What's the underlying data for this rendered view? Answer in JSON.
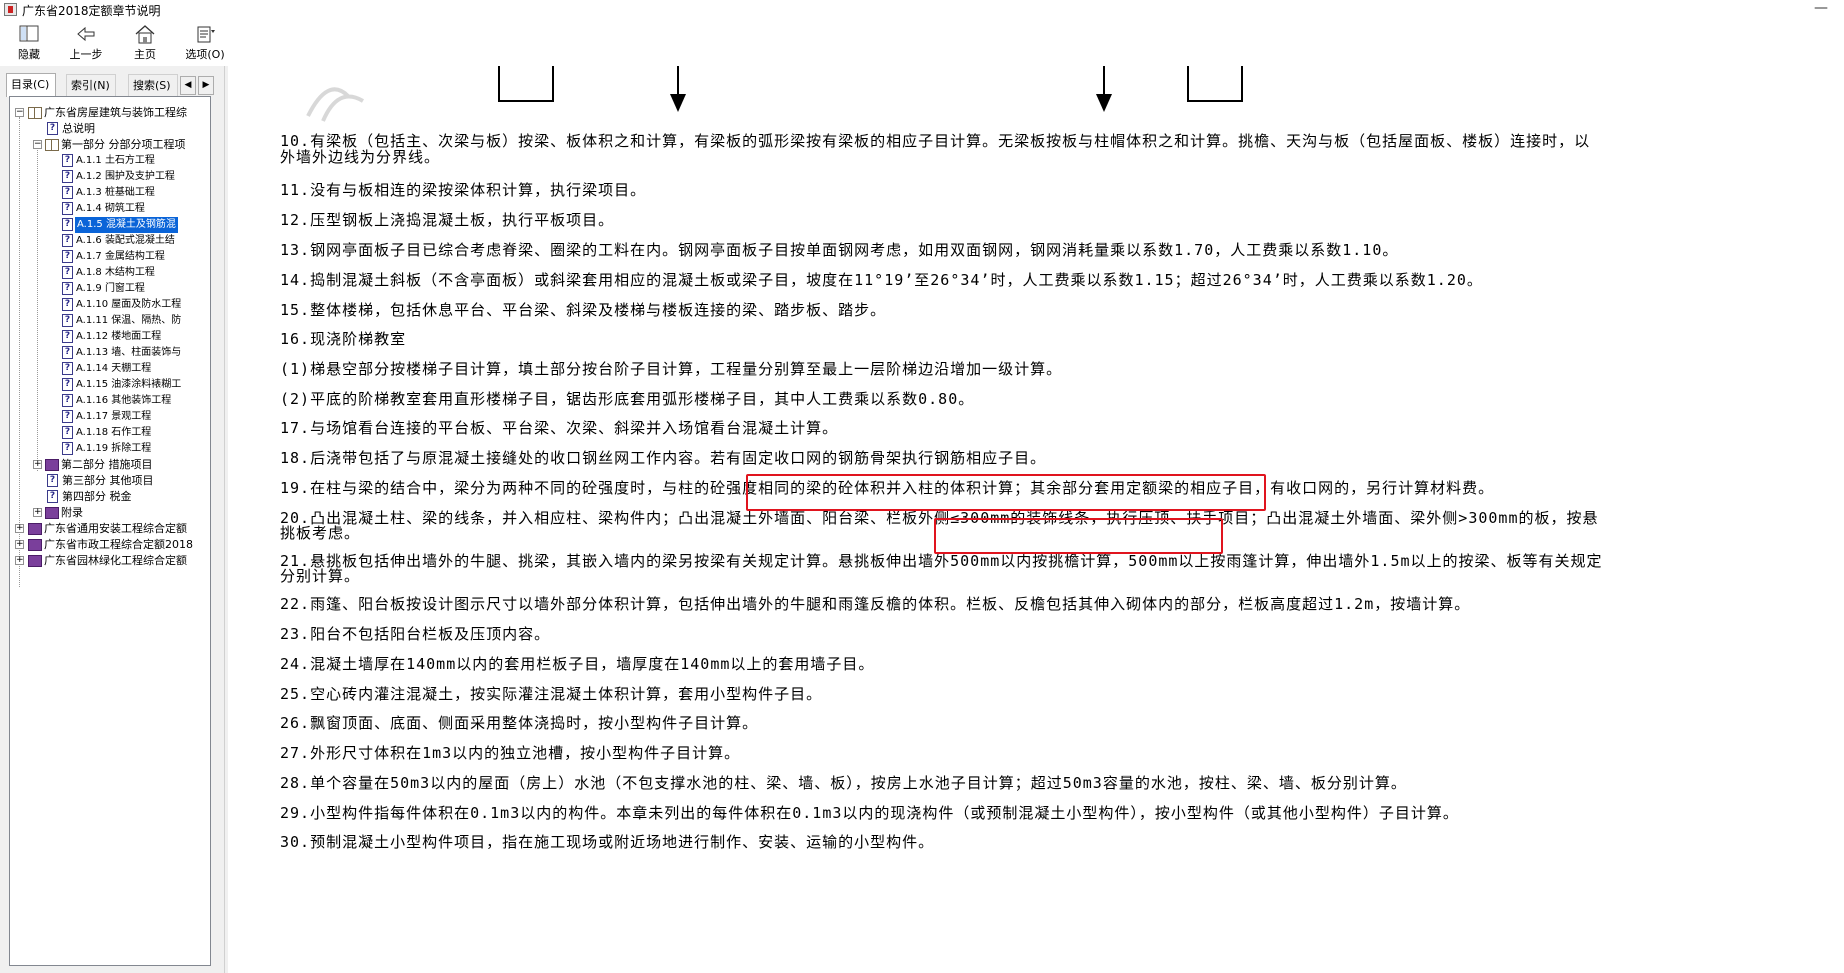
{
  "window": {
    "title": "广东省2018定额章节说明",
    "minimize": "—"
  },
  "toolbar": {
    "hide": "隐藏",
    "back": "上一步",
    "home": "主页",
    "options": "选项(O)"
  },
  "tabs": {
    "contents": "目录(C)",
    "index": "索引(N)",
    "search": "搜索(S)",
    "left_arrow": "◀",
    "right_arrow": "▶"
  },
  "tree": {
    "root": "广东省房屋建筑与装饰工程综",
    "general": "总说明",
    "part1": "第一部分 分部分项工程项",
    "items": [
      {
        "code": "A.1.1",
        "label": "土石方工程"
      },
      {
        "code": "A.1.2",
        "label": "围护及支护工程"
      },
      {
        "code": "A.1.3",
        "label": "桩基础工程"
      },
      {
        "code": "A.1.4",
        "label": "砌筑工程"
      },
      {
        "code": "A.1.5",
        "label": "混凝土及钢筋混"
      },
      {
        "code": "A.1.6",
        "label": "装配式混凝土结"
      },
      {
        "code": "A.1.7",
        "label": "金属结构工程"
      },
      {
        "code": "A.1.8",
        "label": "木结构工程"
      },
      {
        "code": "A.1.9",
        "label": "门窗工程"
      },
      {
        "code": "A.1.10",
        "label": "屋面及防水工程"
      },
      {
        "code": "A.1.11",
        "label": "保温、隔热、防"
      },
      {
        "code": "A.1.12",
        "label": "楼地面工程"
      },
      {
        "code": "A.1.13",
        "label": "墙、柱面装饰与"
      },
      {
        "code": "A.1.14",
        "label": "天棚工程"
      },
      {
        "code": "A.1.15",
        "label": "油漆涂料裱糊工"
      },
      {
        "code": "A.1.16",
        "label": "其他装饰工程"
      },
      {
        "code": "A.1.17",
        "label": "景观工程"
      },
      {
        "code": "A.1.18",
        "label": "石作工程"
      },
      {
        "code": "A.1.19",
        "label": "拆除工程"
      }
    ],
    "part2": "第二部分 措施项目",
    "part3": "第三部分 其他项目",
    "part4": "第四部分 税金",
    "appendix": "附录",
    "books": [
      "广东省通用安装工程综合定额",
      "广东省市政工程综合定额2018",
      "广东省园林绿化工程综合定额"
    ]
  },
  "content": {
    "lines": [
      "10.有梁板（包括主、次梁与板）按梁、板体积之和计算，有梁板的弧形梁按有梁板的相应子目计算。无梁板按板与柱帽体积之和计算。挑檐、天沟与板（包括屋面板、楼板）连接时，以",
      "外墙外边线为分界线。",
      "11.没有与板相连的梁按梁体积计算，执行梁项目。",
      "12.压型钢板上浇捣混凝土板，执行平板项目。",
      "13.钢网亭面板子目已综合考虑脊梁、圈梁的工料在内。钢网亭面板子目按单面钢网考虑，如用双面钢网，钢网消耗量乘以系数1.70，人工费乘以系数1.10。",
      "14.捣制混凝土斜板（不含亭面板）或斜梁套用相应的混凝土板或梁子目，坡度在11°19’至26°34’时，人工费乘以系数1.15；超过26°34’时，人工费乘以系数1.20。",
      "15.整体楼梯，包括休息平台、平台梁、斜梁及楼梯与楼板连接的梁、踏步板、踏步。",
      "16.现浇阶梯教室",
      "(1)梯悬空部分按楼梯子目计算，填土部分按台阶子目计算，工程量分别算至最上一层阶梯边沿增加一级计算。",
      "(2)平底的阶梯教室套用直形楼梯子目，锯齿形底套用弧形楼梯子目，其中人工费乘以系数0.80。",
      "17.与场馆看台连接的平台板、平台梁、次梁、斜梁并入场馆看台混凝土计算。",
      "18.后浇带包括了与原混凝土接缝处的收口钢丝网工作内容。若有固定收口网的钢筋骨架执行钢筋相应子目。",
      "19.在柱与梁的结合中，梁分为两种不同的砼强度时，与柱的砼强度相同的梁的砼体积并入柱的体积计算；其余部分套用定额梁的相应子目，有收口网的，另行计算材料费。",
      "20.凸出混凝土柱、梁的线条，并入相应柱、梁构件内；凸出混凝土外墙面、阳台梁、栏板外侧≤300mm的装饰线条，执行压顶、扶手项目；凸出混凝土外墙面、梁外侧>300mm的板，按悬",
      "挑板考虑。",
      "21.悬挑板包括伸出墙外的牛腿、挑梁，其嵌入墙内的梁另按梁有关规定计算。悬挑板伸出墙外500mm以内按挑檐计算，500mm以上按雨篷计算，伸出墙外1.5m以上的按梁、板等有关规定",
      "分别计算。",
      "22.雨篷、阳台板按设计图示尺寸以墙外部分体积计算，包括伸出墙外的牛腿和雨篷反檐的体积。栏板、反檐包括其伸入砌体内的部分，栏板高度超过1.2m，按墙计算。",
      "23.阳台不包括阳台栏板及压顶内容。",
      "24.混凝土墙厚在140mm以内的套用栏板子目，墙厚度在140mm以上的套用墙子目。",
      "25.空心砖内灌注混凝土，按实际灌注混凝土体积计算，套用小型构件子目。",
      "26.飘窗顶面、底面、侧面采用整体浇捣时，按小型构件子目计算。",
      "27.外形尺寸体积在1m3以内的独立池槽，按小型构件子目计算。",
      "28.单个容量在50m3以内的屋面（房上）水池（不包支撑水池的柱、梁、墙、板），按房上水池子目计算；超过50m3容量的水池，按柱、梁、墙、板分别计算。",
      "29.小型构件指每件体积在0.1m3以内的构件。本章未列出的每件体积在0.1m3以内的现浇构件（或预制混凝土小型构件），按小型构件（或其他小型构件）子目计算。",
      "30.预制混凝土小型构件项目，指在施工现场或附近场地进行制作、安装、运输的小型构件。"
    ]
  },
  "colors": {
    "highlight_box": "#e0141e",
    "tree_selection": "#0a64d8",
    "pane_bg": "#f0f0f0"
  }
}
